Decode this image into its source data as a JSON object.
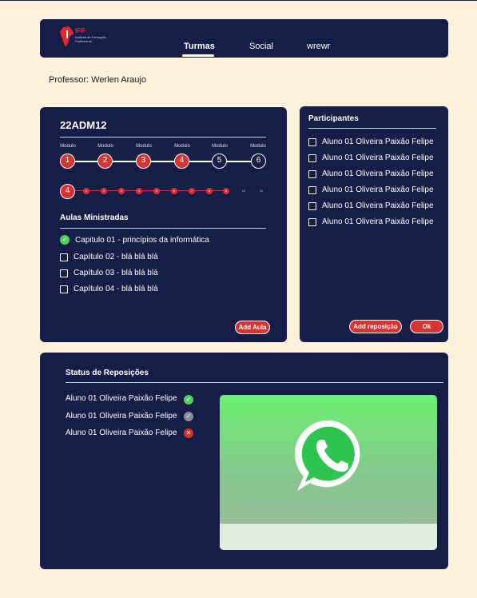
{
  "nav": {
    "logo_text": "IFP",
    "logo_subtext": "Instituto de Formação Profissional",
    "items": [
      {
        "label": "Turmas",
        "active": true
      },
      {
        "label": "Social",
        "active": false
      },
      {
        "label": "wrewr",
        "active": false
      }
    ]
  },
  "professor": "Professor: Werlen Araujo",
  "class_card": {
    "title": "22ADM12",
    "modules": [
      {
        "label": "Modulo",
        "number": "1",
        "done": true
      },
      {
        "label": "Modulo",
        "number": "2",
        "done": true
      },
      {
        "label": "Modulo",
        "number": "3",
        "done": true
      },
      {
        "label": "Modulo",
        "number": "4",
        "done": true
      },
      {
        "label": "Modulo",
        "number": "5",
        "done": false
      },
      {
        "label": "Modulo",
        "number": "6",
        "done": false
      }
    ],
    "current_module": "4",
    "lessons_progress": [
      {
        "n": "1",
        "done": true
      },
      {
        "n": "2",
        "done": true
      },
      {
        "n": "3",
        "done": true
      },
      {
        "n": "4",
        "done": true
      },
      {
        "n": "5",
        "done": true
      },
      {
        "n": "6",
        "done": true
      },
      {
        "n": "7",
        "done": true
      },
      {
        "n": "8",
        "done": true
      },
      {
        "n": "9",
        "done": true
      },
      {
        "n": "10",
        "done": false
      },
      {
        "n": "11",
        "done": false
      }
    ],
    "section_title": "Aulas Ministradas",
    "lessons": [
      {
        "label": "Capitulo 01 - princípios da informática",
        "done": true
      },
      {
        "label": "Capítulo 02 - blá blá blá",
        "done": false
      },
      {
        "label": "Capítulo 03 - blá blá blá",
        "done": false
      },
      {
        "label": "Capítulo 04 - blá blá blá",
        "done": false
      }
    ],
    "add_button": "Add Aula"
  },
  "participants_card": {
    "title": "Participantes",
    "items": [
      "Aluno 01 Oliveira Paixão Felipe",
      "Aluno 01 Oliveira Paixão Felipe",
      "Aluno 01 Oliveira Paixão Felipe",
      "Aluno 01 Oliveira Paixão Felipe",
      "Aluno 01 Oliveira Paixão Felipe",
      "Aluno 01 Oliveira Paixão Felipe"
    ],
    "add_button": "Add reposição",
    "ok_button": "Ok"
  },
  "status_card": {
    "title": "Status de  Reposições",
    "rows": [
      {
        "name": "Aluno 01 Oliveira Paixão Felipe",
        "status": "approved",
        "icon": "check-green-icon"
      },
      {
        "name": "Aluno 01 Oliveira Paixão Felipe",
        "status": "pending",
        "icon": "check-gray-icon"
      },
      {
        "name": "Aluno 01 Oliveira Paixão Felipe",
        "status": "rejected",
        "icon": "x-red-icon"
      }
    ],
    "image_icon": "whatsapp-icon"
  },
  "colors": {
    "background": "#fdf1dc",
    "card": "#161d47",
    "accent_red": "#d63333",
    "success_green": "#4cd05a",
    "whatsapp_green": "#25d366"
  }
}
